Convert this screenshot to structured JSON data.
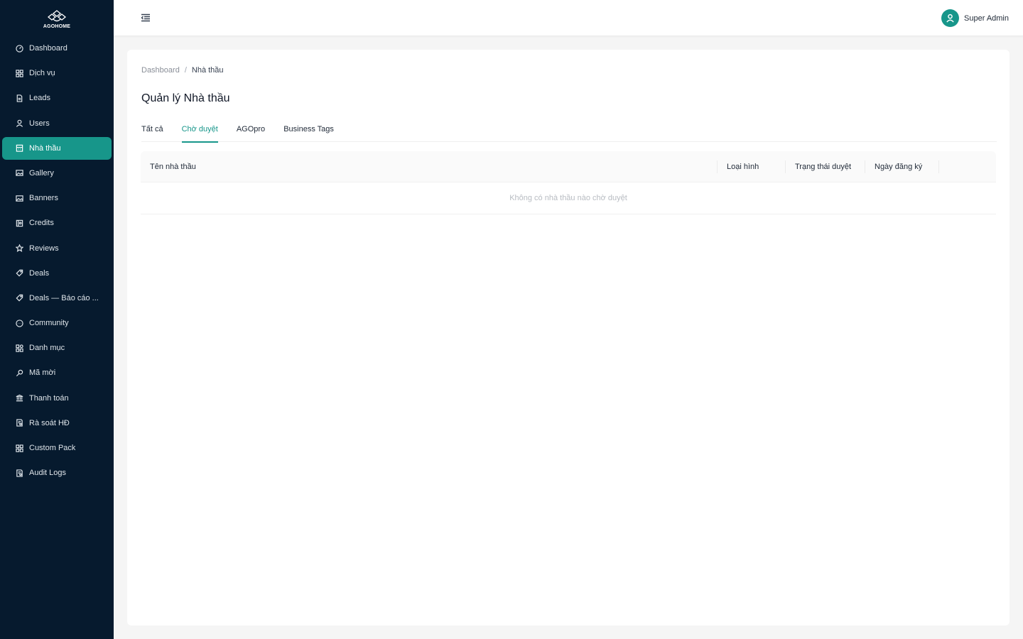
{
  "brand": {
    "name": "AGOHOME",
    "accent": "#17968a",
    "sidebar_bg": "#061a2e"
  },
  "sidebar": {
    "items": [
      {
        "label": "Dashboard",
        "icon": "dashboard-icon"
      },
      {
        "label": "Dịch vụ",
        "icon": "grid-icon"
      },
      {
        "label": "Leads",
        "icon": "document-icon"
      },
      {
        "label": "Users",
        "icon": "user-icon"
      },
      {
        "label": "Nhà thầu",
        "icon": "building-icon",
        "active": true
      },
      {
        "label": "Gallery",
        "icon": "image-icon"
      },
      {
        "label": "Banners",
        "icon": "image-icon"
      },
      {
        "label": "Credits",
        "icon": "wallet-icon"
      },
      {
        "label": "Reviews",
        "icon": "star-icon"
      },
      {
        "label": "Deals",
        "icon": "tag-icon"
      },
      {
        "label": "Deals — Báo cáo ...",
        "icon": "tag-icon"
      },
      {
        "label": "Community",
        "icon": "chat-icon"
      },
      {
        "label": "Danh mục",
        "icon": "category-icon"
      },
      {
        "label": "Mã mời",
        "icon": "key-icon"
      },
      {
        "label": "Thanh toán",
        "icon": "bank-icon"
      },
      {
        "label": "Rà soát HĐ",
        "icon": "audit-icon"
      },
      {
        "label": "Custom Pack",
        "icon": "grid-icon"
      },
      {
        "label": "Audit Logs",
        "icon": "audit-icon"
      }
    ]
  },
  "header": {
    "user_name": "Super Admin"
  },
  "breadcrumb": {
    "root": "Dashboard",
    "separator": "/",
    "current": "Nhà thầu"
  },
  "page": {
    "title": "Quản lý Nhà thầu"
  },
  "tabs": [
    {
      "label": "Tất cả"
    },
    {
      "label": "Chờ duyệt",
      "active": true
    },
    {
      "label": "AGOpro"
    },
    {
      "label": "Business Tags"
    }
  ],
  "table": {
    "columns": [
      "Tên nhà thầu",
      "Loại hình",
      "Trạng thái duyệt",
      "Ngày đăng ký",
      ""
    ],
    "empty_text": "Không có nhà thầu nào chờ duyệt"
  }
}
